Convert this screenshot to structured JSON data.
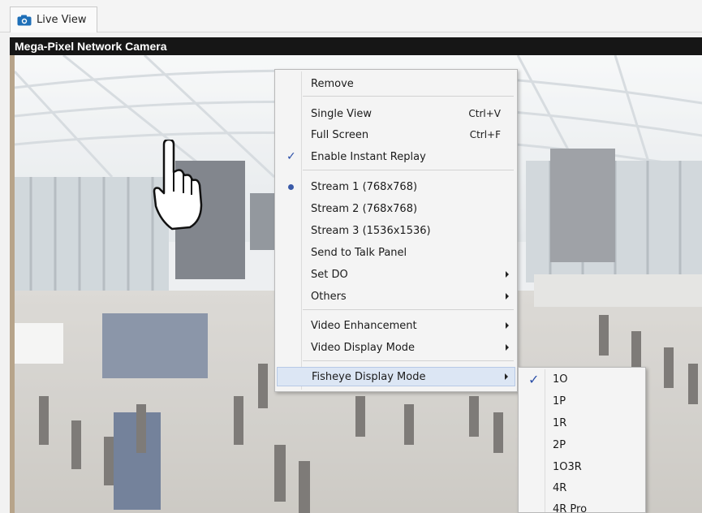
{
  "tab": {
    "label": "Live View",
    "icon": "camera-icon",
    "accent": "#1e6fb8"
  },
  "camera": {
    "title": "Mega-Pixel Network Camera"
  },
  "context_menu": {
    "items": [
      {
        "label": "Remove",
        "shortcut": "",
        "check": false,
        "radio": false,
        "submenu": false
      },
      {
        "label": "Single View",
        "shortcut": "Ctrl+V",
        "check": false,
        "radio": false,
        "submenu": false
      },
      {
        "label": "Full Screen",
        "shortcut": "Ctrl+F",
        "check": false,
        "radio": false,
        "submenu": false
      },
      {
        "label": "Enable Instant Replay",
        "shortcut": "",
        "check": true,
        "radio": false,
        "submenu": false
      },
      {
        "label": "Stream 1 (768x768)",
        "shortcut": "",
        "check": false,
        "radio": true,
        "submenu": false
      },
      {
        "label": "Stream 2 (768x768)",
        "shortcut": "",
        "check": false,
        "radio": false,
        "submenu": false
      },
      {
        "label": "Stream 3 (1536x1536)",
        "shortcut": "",
        "check": false,
        "radio": false,
        "submenu": false
      },
      {
        "label": "Send to Talk Panel",
        "shortcut": "",
        "check": false,
        "radio": false,
        "submenu": false
      },
      {
        "label": "Set DO",
        "shortcut": "",
        "check": false,
        "radio": false,
        "submenu": true
      },
      {
        "label": "Others",
        "shortcut": "",
        "check": false,
        "radio": false,
        "submenu": true
      },
      {
        "label": "Video Enhancement",
        "shortcut": "",
        "check": false,
        "radio": false,
        "submenu": true
      },
      {
        "label": "Video Display Mode",
        "shortcut": "",
        "check": false,
        "radio": false,
        "submenu": true
      },
      {
        "label": "Fisheye Display Mode",
        "shortcut": "",
        "check": false,
        "radio": false,
        "submenu": true,
        "highlighted": true
      }
    ]
  },
  "fisheye_submenu": {
    "items": [
      {
        "label": "1O",
        "checked": true
      },
      {
        "label": "1P",
        "checked": false
      },
      {
        "label": "1R",
        "checked": false
      },
      {
        "label": "2P",
        "checked": false
      },
      {
        "label": "1O3R",
        "checked": false
      },
      {
        "label": "4R",
        "checked": false
      },
      {
        "label": "4R Pro",
        "checked": false
      }
    ]
  },
  "cursor": {
    "icon": "hand-pointer-icon"
  }
}
